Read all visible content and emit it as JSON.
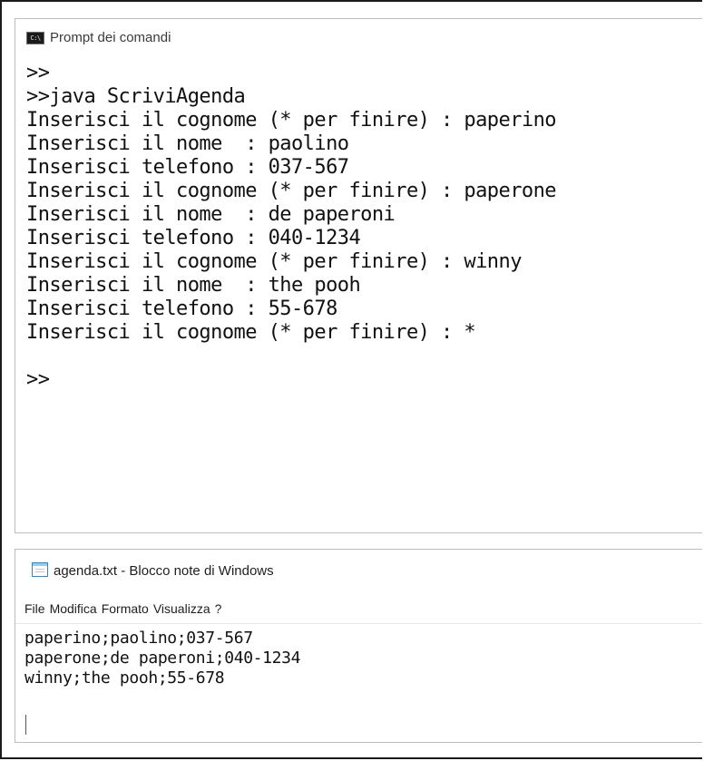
{
  "console": {
    "title": "Prompt dei comandi",
    "icon": "cmd-icon",
    "icon_text": "C:\\",
    "lines": [
      ">>",
      ">>java ScriviAgenda",
      "Inserisci il cognome (* per finire) : paperino",
      "Inserisci il nome  : paolino",
      "Inserisci telefono : 037-567",
      "Inserisci il cognome (* per finire) : paperone",
      "Inserisci il nome  : de paperoni",
      "Inserisci telefono : 040-1234",
      "Inserisci il cognome (* per finire) : winny",
      "Inserisci il nome  : the pooh",
      "Inserisci telefono : 55-678",
      "Inserisci il cognome (* per finire) : *",
      "",
      ">>"
    ]
  },
  "notepad": {
    "title": "agenda.txt - Blocco note di Windows",
    "icon": "notepad-icon",
    "menu": [
      "File",
      "Modifica",
      "Formato",
      "Visualizza",
      "?"
    ],
    "lines": [
      "paperino;paolino;037-567",
      "paperone;de paperoni;040-1234",
      "winny;the pooh;55-678"
    ]
  }
}
